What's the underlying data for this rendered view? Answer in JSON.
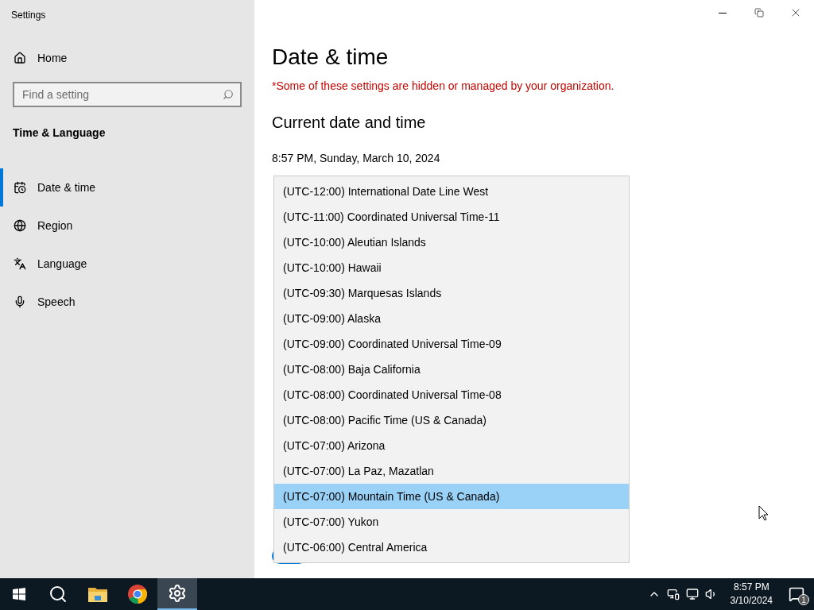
{
  "window": {
    "title": "Settings"
  },
  "sidebar": {
    "home": "Home",
    "search": {
      "placeholder": "Find a setting"
    },
    "section": "Time & Language",
    "items": [
      {
        "label": "Date & time",
        "selected": true
      },
      {
        "label": "Region",
        "selected": false
      },
      {
        "label": "Language",
        "selected": false
      },
      {
        "label": "Speech",
        "selected": false
      }
    ]
  },
  "main": {
    "title": "Date & time",
    "notice": "*Some of these settings are hidden or managed by your organization.",
    "heading": "Current date and time",
    "current": "8:57 PM, Sunday, March 10, 2024",
    "toggle": {
      "on": true
    },
    "timezone_list": [
      {
        "label": "(UTC-12:00) International Date Line West",
        "selected": false
      },
      {
        "label": "(UTC-11:00) Coordinated Universal Time-11",
        "selected": false
      },
      {
        "label": "(UTC-10:00) Aleutian Islands",
        "selected": false
      },
      {
        "label": "(UTC-10:00) Hawaii",
        "selected": false
      },
      {
        "label": "(UTC-09:30) Marquesas Islands",
        "selected": false
      },
      {
        "label": "(UTC-09:00) Alaska",
        "selected": false
      },
      {
        "label": "(UTC-09:00) Coordinated Universal Time-09",
        "selected": false
      },
      {
        "label": "(UTC-08:00) Baja California",
        "selected": false
      },
      {
        "label": "(UTC-08:00) Coordinated Universal Time-08",
        "selected": false
      },
      {
        "label": "(UTC-08:00) Pacific Time (US & Canada)",
        "selected": false
      },
      {
        "label": "(UTC-07:00) Arizona",
        "selected": false
      },
      {
        "label": "(UTC-07:00) La Paz, Mazatlan",
        "selected": false
      },
      {
        "label": "(UTC-07:00) Mountain Time (US & Canada)",
        "selected": true
      },
      {
        "label": "(UTC-07:00) Yukon",
        "selected": false
      },
      {
        "label": "(UTC-06:00) Central America",
        "selected": false
      }
    ]
  },
  "taskbar": {
    "apps": [
      {
        "selected": false
      },
      {
        "selected": false
      },
      {
        "selected": false
      },
      {
        "selected": true
      }
    ],
    "time": "8:57 PM",
    "date": "3/10/2024",
    "notifications": "1"
  }
}
